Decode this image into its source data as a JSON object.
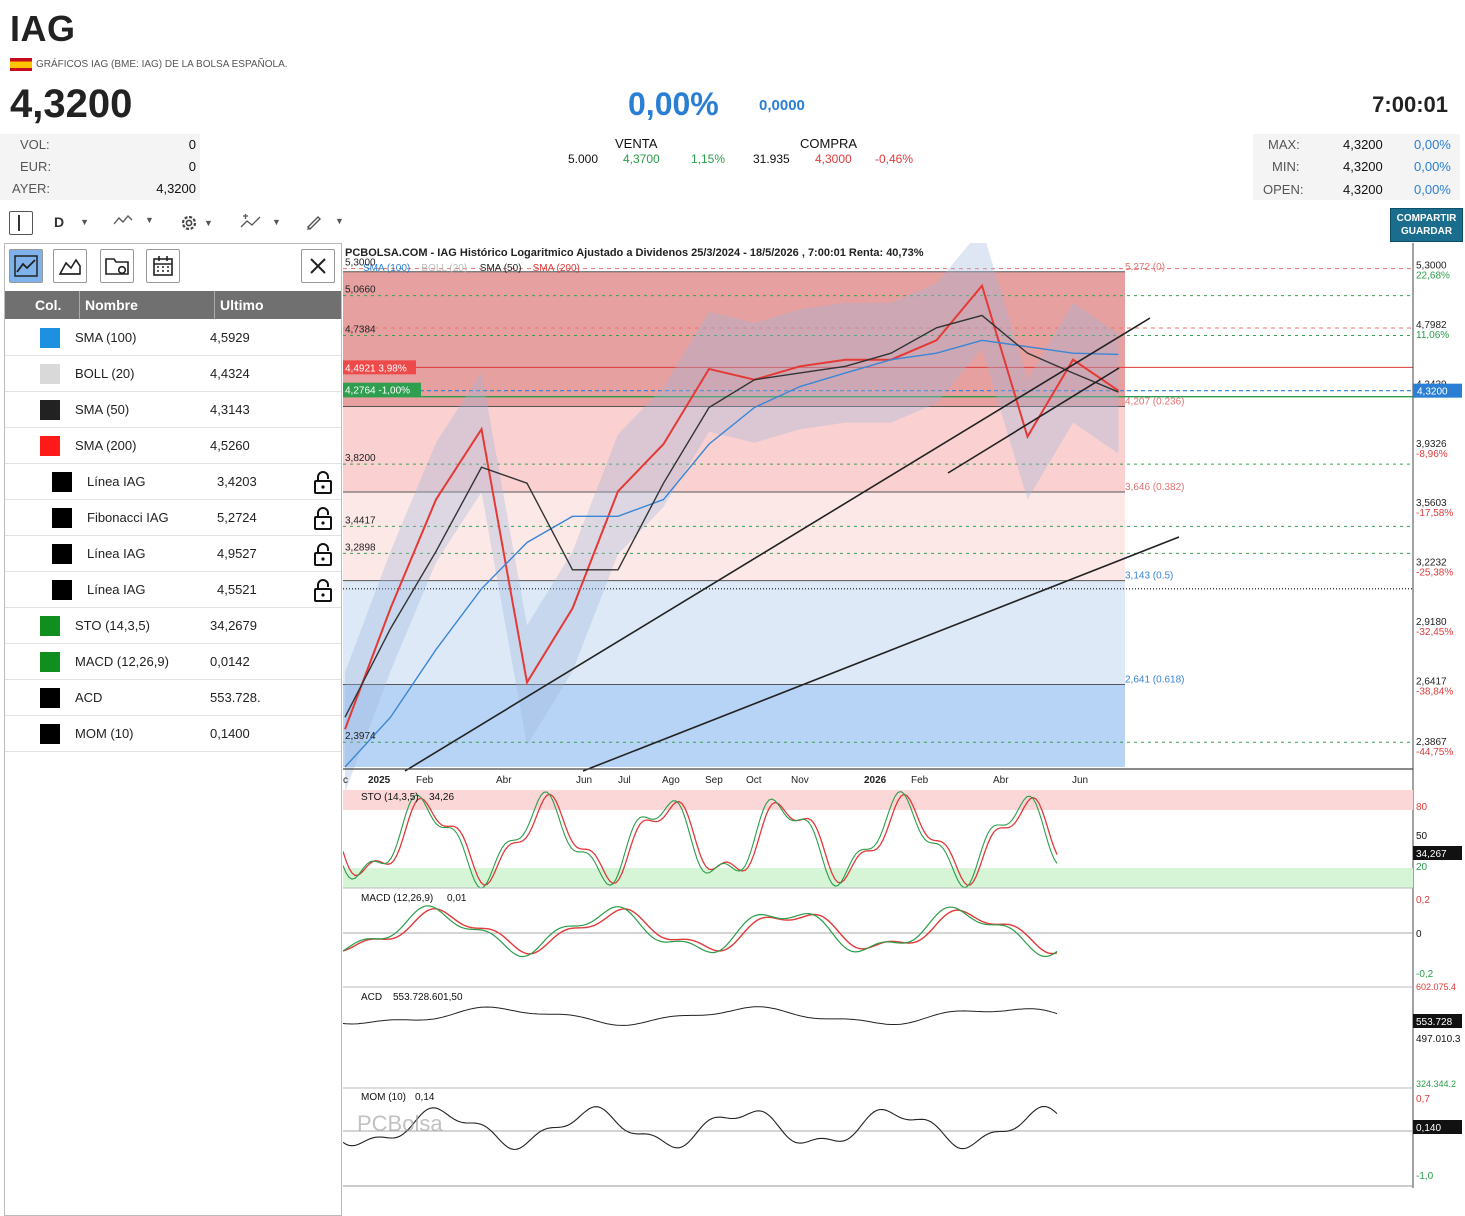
{
  "header": {
    "ticker": "IAG",
    "subtitle": "GRÁFICOS IAG (BME: IAG) DE LA BOLSA ESPAÑOLA.",
    "price": "4,3200",
    "change_pct": "0,00%",
    "change_abs": "0,0000",
    "time": "7:00:01"
  },
  "stats_left": [
    {
      "label": "VOL:",
      "value": "0"
    },
    {
      "label": "EUR:",
      "value": "0"
    },
    {
      "label": "AYER:",
      "value": "4,3200"
    }
  ],
  "orderbook": {
    "venta_label": "VENTA",
    "compra_label": "COMPRA",
    "venta_qty": "5.000",
    "venta_price": "4,3700",
    "venta_pct": "1,15%",
    "compra_qty": "31.935",
    "compra_price": "4,3000",
    "compra_pct": "-0,46%"
  },
  "stats_right": [
    {
      "label": "MAX:",
      "value": "4,3200",
      "pct": "0,00%"
    },
    {
      "label": "MIN:",
      "value": "4,3200",
      "pct": "0,00%"
    },
    {
      "label": "OPEN:",
      "value": "4,3200",
      "pct": "0,00%"
    }
  ],
  "toolbar": {
    "period": "D",
    "share_label_1": "COMPARTIR",
    "share_label_2": "GUARDAR",
    "icons": [
      "panel-toggle-icon",
      "line-style-icon",
      "gear-icon",
      "indicator-icon",
      "pen-icon"
    ]
  },
  "panel": {
    "col_header": "Col.",
    "name_header": "Nombre",
    "last_header": "Ultimo",
    "rows": [
      {
        "name": "SMA (100)",
        "value": "4,5929",
        "color": "#1e90e0",
        "indent": false,
        "lock": false
      },
      {
        "name": "BOLL (20)",
        "value": "4,4324",
        "color": "#d9d9d9",
        "indent": false,
        "lock": false
      },
      {
        "name": "SMA (50)",
        "value": "4,3143",
        "color": "#222222",
        "indent": false,
        "lock": false
      },
      {
        "name": "SMA (200)",
        "value": "4,5260",
        "color": "#ff1a1a",
        "indent": false,
        "lock": false
      },
      {
        "name": "Línea IAG",
        "value": "3,4203",
        "color": "#000000",
        "indent": true,
        "lock": true
      },
      {
        "name": "Fibonacci IAG",
        "value": "5,2724",
        "color": "#000000",
        "indent": true,
        "lock": true
      },
      {
        "name": "Línea IAG",
        "value": "4,9527",
        "color": "#000000",
        "indent": true,
        "lock": true
      },
      {
        "name": "Línea IAG",
        "value": "4,5521",
        "color": "#000000",
        "indent": true,
        "lock": true
      },
      {
        "name": "STO (14,3,5)",
        "value": "34,2679",
        "color": "#118f1e",
        "indent": false,
        "lock": false
      },
      {
        "name": "MACD (12,26,9)",
        "value": "0,0142",
        "color": "#118f1e",
        "indent": false,
        "lock": false
      },
      {
        "name": "ACD",
        "value": "553.728.",
        "color": "#000000",
        "indent": false,
        "lock": false
      },
      {
        "name": "MOM (10)",
        "value": "0,1400",
        "color": "#000000",
        "indent": false,
        "lock": false
      }
    ]
  },
  "chart": {
    "title": "PCBOLSA.COM - IAG Histórico Logaritmico Ajustado a Dividenos 25/3/2024 - 18/5/2026 , 7:00:01 Renta: 40,73%",
    "legend": [
      "SMA (100)",
      "BOLL (20)",
      "SMA (50)",
      "SMA (200)"
    ],
    "legend_colors": [
      "#2a7fd4",
      "#bbbbbb",
      "#222222",
      "#e03a3a"
    ],
    "left_price_labels": [
      "5,3000",
      "5,0660",
      "4,7384",
      "3,8200",
      "3,4417",
      "3,2898",
      "2,3974"
    ],
    "tag_high": "4,4921  3,98%",
    "tag_low": "4,2764  -1,00%",
    "fib_labels": [
      "5,272 (0)",
      "4,207 (0.236)",
      "3,646 (0.382)",
      "3,143 (0.5)",
      "2,641 (0.618)"
    ],
    "right_axis": [
      {
        "value": "5,3000",
        "pct": "22,68%",
        "pct_color": "green"
      },
      {
        "value": "4,7982",
        "pct": "11,06%",
        "pct_color": "green"
      },
      {
        "value": "4,3439",
        "pct": "",
        "pct_color": "none"
      },
      {
        "value": "3,9326",
        "pct": "-8,96%",
        "pct_color": "red"
      },
      {
        "value": "3,5603",
        "pct": "-17,58%",
        "pct_color": "red"
      },
      {
        "value": "3,2232",
        "pct": "-25,38%",
        "pct_color": "red"
      },
      {
        "value": "2,9180",
        "pct": "-32,45%",
        "pct_color": "red"
      },
      {
        "value": "2,6417",
        "pct": "-38,84%",
        "pct_color": "red"
      },
      {
        "value": "2,3867",
        "pct": "-44,75%",
        "pct_color": "red"
      }
    ],
    "current_price_tag": "4,3200",
    "x_labels": [
      "c",
      "2025",
      "Feb",
      "Abr",
      "Jun",
      "Jul",
      "Ago",
      "Sep",
      "Oct",
      "Nov",
      "2026",
      "Feb",
      "Abr",
      "Jun"
    ],
    "sto": {
      "label": "STO (14,3,5)",
      "value": "34,26",
      "axis": [
        "80",
        "50",
        "20"
      ],
      "tag": "34,267"
    },
    "macd": {
      "label": "MACD (12,26,9)",
      "value": "0,01",
      "axis": [
        "0,2",
        "0",
        "-0,2"
      ]
    },
    "acd": {
      "label": "ACD",
      "value": "553.728.601,50",
      "axis_top": "602.075.4",
      "tag": "553.728",
      "axis_bottom": "497.010.3"
    },
    "mom": {
      "label": "MOM (10)",
      "value": "0,14",
      "axis_top": "324.344.2",
      "axis": [
        "0,7",
        "-1,0"
      ],
      "tag": "0,140"
    },
    "watermark": "PCBolsa"
  },
  "chart_data": {
    "type": "line",
    "title": "PCBOLSA.COM - IAG Histórico Logaritmico Ajustado a Dividenos 25/3/2024 - 18/5/2026 , 7:00:01 Renta: 40,73%",
    "x_period": [
      "2024-12",
      "2025-01",
      "2025-02",
      "2025-03",
      "2025-04",
      "2025-05",
      "2025-06",
      "2025-07",
      "2025-08",
      "2025-09",
      "2025-10",
      "2025-11",
      "2025-12",
      "2026-01",
      "2026-02",
      "2026-03",
      "2026-04",
      "2026-05"
    ],
    "series": [
      {
        "name": "SMA (200)",
        "values": [
          2.45,
          3.0,
          3.6,
          4.05,
          2.65,
          3.0,
          3.65,
          3.95,
          4.48,
          4.4,
          4.5,
          4.55,
          4.55,
          4.7,
          5.15,
          4.0,
          4.55,
          4.32
        ]
      },
      {
        "name": "SMA (100)",
        "values": [
          2.3,
          2.5,
          2.8,
          3.1,
          3.35,
          3.5,
          3.5,
          3.6,
          3.95,
          4.2,
          4.35,
          4.45,
          4.55,
          4.6,
          4.7,
          4.65,
          4.6,
          4.59
        ]
      },
      {
        "name": "SMA (50)",
        "values": [
          2.5,
          2.9,
          3.3,
          3.8,
          3.7,
          3.2,
          3.2,
          3.7,
          4.2,
          4.4,
          4.45,
          4.5,
          4.6,
          4.8,
          4.9,
          4.6,
          4.45,
          4.31
        ]
      }
    ],
    "ylim": [
      2.3,
      5.35
    ]
  }
}
